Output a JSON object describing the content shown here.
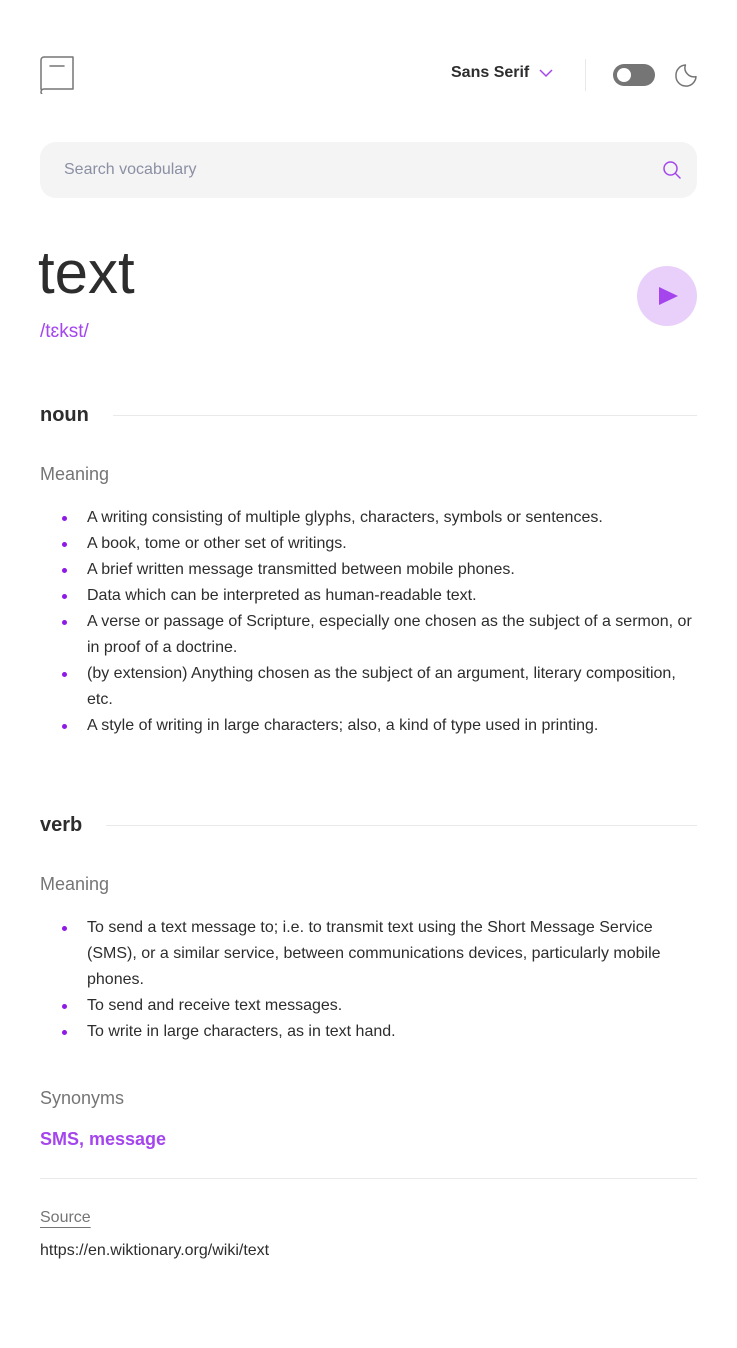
{
  "header": {
    "logo_icon": "book-icon",
    "font_select": {
      "selected": "Sans Serif",
      "icon": "chevron-down-icon"
    },
    "theme_toggle": {
      "state": "off"
    },
    "theme_icon": "moon-icon"
  },
  "search": {
    "placeholder": "Search vocabulary",
    "value": "",
    "icon": "search-icon"
  },
  "entry": {
    "word": "text",
    "phonetic": "/tɛkst/",
    "play_icon": "play-icon"
  },
  "meanings": [
    {
      "part_of_speech": "noun",
      "meaning_label": "Meaning",
      "definitions": [
        "A writing consisting of multiple glyphs, characters, symbols or sentences.",
        "A book, tome or other set of writings.",
        "A brief written message transmitted between mobile phones.",
        "Data which can be interpreted as human-readable text.",
        "A verse or passage of Scripture, especially one chosen as the subject of a sermon, or in proof of a doctrine.",
        "(by extension) Anything chosen as the subject of an argument, literary composition, etc.",
        "A style of writing in large characters; also, a kind of type used in printing."
      ]
    },
    {
      "part_of_speech": "verb",
      "meaning_label": "Meaning",
      "definitions": [
        "To send a text message to; i.e. to transmit text using the Short Message Service (SMS), or a similar service, between communications devices, particularly mobile phones.",
        "To send and receive text messages.",
        "To write in large characters, as in text hand."
      ],
      "synonyms_label": "Synonyms",
      "synonyms": "SMS, message"
    }
  ],
  "source": {
    "label": "Source",
    "url": "https://en.wiktionary.org/wiki/text"
  },
  "colors": {
    "accent": "#a445ed",
    "bullet": "#8f19e8",
    "play_bg": "#e9d0fa",
    "text": "#2d2d2d",
    "muted": "#757575",
    "search_bg": "#f4f4f4",
    "divider": "#e9e9e9"
  }
}
